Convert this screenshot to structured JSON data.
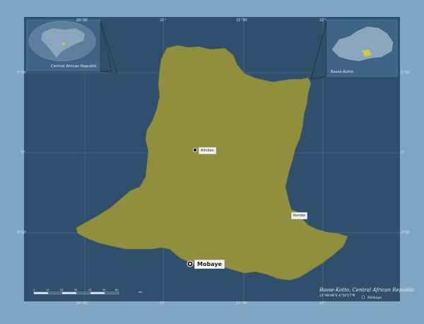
{
  "map": {
    "region_name": "Basse-Kotto",
    "country": "Central African Republic",
    "title": "Basse-Kotto, Central African Republic",
    "center_coords": "21°48'48\"E  4°18'17\"N",
    "colors": {
      "background": "#7fa6c2",
      "water": "#2f4f6d",
      "region_fill": "#8f8f3d",
      "graticule": "#5f7c96"
    }
  },
  "graticule": {
    "top": [
      "20°30'",
      "21°",
      "21°30'",
      "22°"
    ],
    "bottom": [
      "20°30'",
      "21°",
      "21°30'",
      "22°"
    ],
    "left": [
      "5°30'",
      "5°",
      "4°30'"
    ],
    "right": [
      "5°30'",
      "5°",
      "4°30'"
    ]
  },
  "places": {
    "capital": "Mobaye",
    "towns": [
      "Alindao",
      "Kembe"
    ]
  },
  "inset_world": {
    "label": "Central African Republic"
  },
  "inset_country": {
    "label": "Basse-Kotto"
  },
  "legend": {
    "capital_symbol_label": "Mobaye"
  },
  "scale_bar": {
    "labels": [
      "0",
      "10",
      "20",
      "30",
      "40",
      "50",
      "60",
      "km"
    ]
  }
}
